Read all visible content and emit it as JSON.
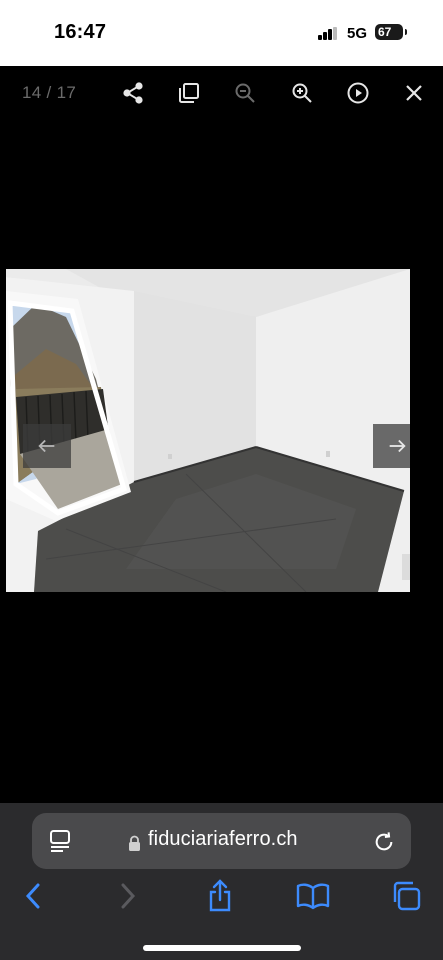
{
  "status_bar": {
    "time": "16:47",
    "network": "5G",
    "battery": "67",
    "icons": [
      "signal-bars-icon",
      "battery-icon"
    ]
  },
  "viewer": {
    "counter": "14 / 17",
    "icons": [
      "share-icon",
      "fullscreen-icon",
      "zoom-out-icon",
      "zoom-in-icon",
      "slideshow-play-icon",
      "close-icon"
    ]
  },
  "photo": {
    "nav_icons": [
      "previous-arrow-icon",
      "next-arrow-icon"
    ]
  },
  "browser": {
    "url": "fiduciariaferro.ch",
    "icons": [
      "tab-layout-icon",
      "lock-icon",
      "reload-icon",
      "back-icon",
      "forward-icon",
      "share-icon",
      "bookmarks-icon",
      "tabs-icon"
    ],
    "accent_color": "#3d8bfd"
  }
}
